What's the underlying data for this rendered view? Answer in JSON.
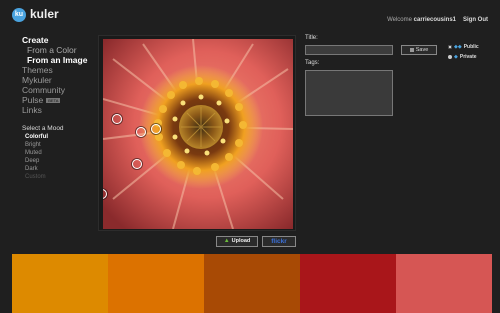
{
  "header": {
    "logo_badge": "ku",
    "logo_text": "kuler",
    "welcome_prefix": "Welcome ",
    "username": "carriecousins1",
    "sign_out": "Sign Out"
  },
  "sidebar": {
    "create": "Create",
    "from_color": "From a Color",
    "from_image": "From an Image",
    "themes": "Themes",
    "mykuler": "Mykuler",
    "community": "Community",
    "pulse": "Pulse",
    "pulse_badge": "BETA",
    "links": "Links",
    "mood_title": "Select a Mood",
    "moods": [
      "Colorful",
      "Bright",
      "Muted",
      "Deep",
      "Dark",
      "Custom"
    ]
  },
  "image_panel": {
    "upload_label": "Upload",
    "flickr_label": "flickr"
  },
  "form": {
    "title_label": "Title:",
    "title_value": "",
    "save_label": "Save",
    "public_label": "Public",
    "private_label": "Private",
    "tags_label": "Tags:",
    "tags_value": ""
  },
  "swatches": [
    "#dd8a00",
    "#dc7200",
    "#a84a05",
    "#a9161a",
    "#d65654"
  ],
  "colors": {
    "accent": "#4aa3df",
    "background": "#1f1f1f"
  }
}
